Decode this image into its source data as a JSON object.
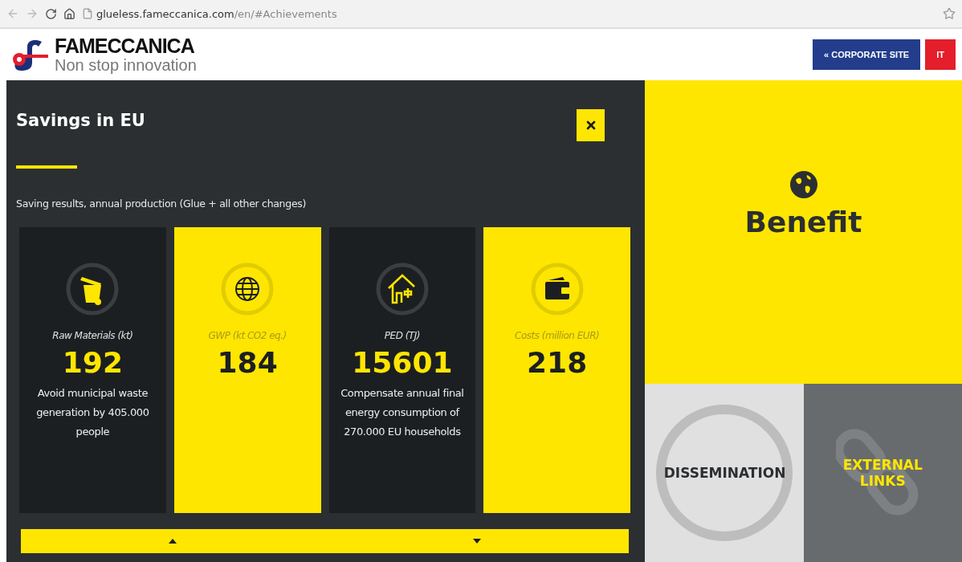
{
  "browser": {
    "url_host": "glueless.fameccanica.com",
    "url_path": "/en/#Achievements"
  },
  "header": {
    "brand": "FAMECCANICA",
    "tagline": "Non stop innovation",
    "buttons": [
      {
        "label": "« CORPORATE SITE",
        "kind": "corporate"
      },
      {
        "label": "IT",
        "kind": "language"
      }
    ]
  },
  "panel": {
    "title": "Savings in EU",
    "subtitle": "Saving results, annual production (Glue + all other changes)",
    "cards": [
      {
        "kind": "dark",
        "label": "Raw Materials (kt)",
        "value": "192",
        "note": "Avoid municipal waste generation by 405.000 people"
      },
      {
        "kind": "yellow",
        "label": "GWP (kt CO2 eq.)",
        "value": "184"
      },
      {
        "kind": "dark",
        "label": "PED (TJ)",
        "value": "15601",
        "note": "Compensate annual final energy consumption of 270.000 EU households"
      },
      {
        "kind": "yellow",
        "label": "Costs (million EUR)",
        "value": "218"
      }
    ]
  },
  "tiles": {
    "benefit": "Benefit",
    "dissemination": "DISSEMINATION",
    "external": "EXTERNAL LINKS"
  }
}
